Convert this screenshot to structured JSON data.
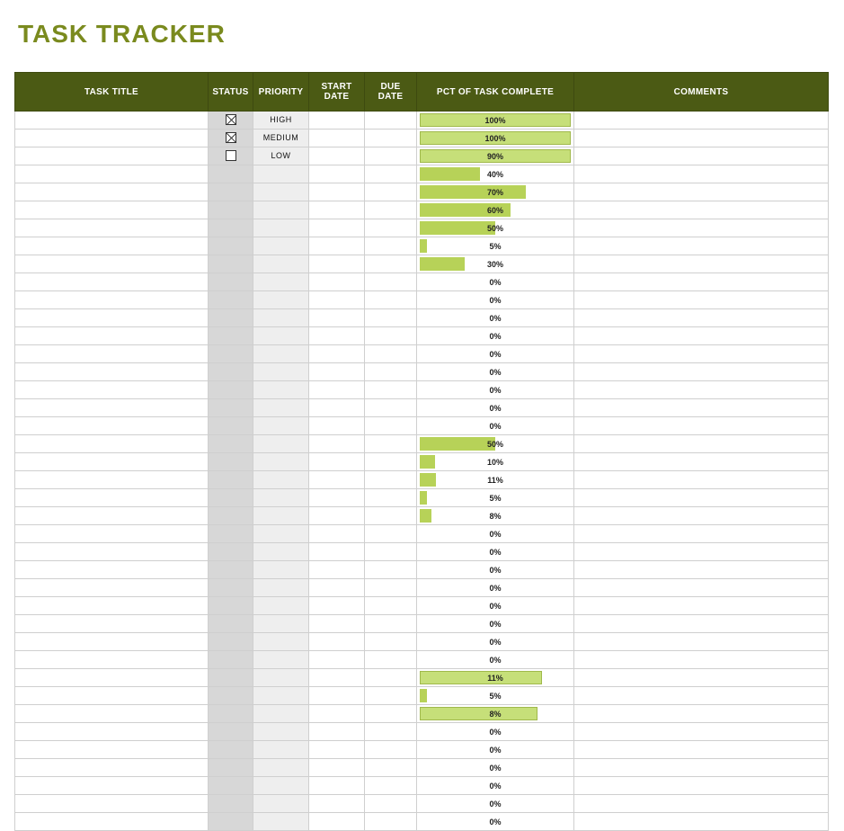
{
  "title": "TASK TRACKER",
  "columns": {
    "task_title": "TASK TITLE",
    "status": "STATUS",
    "priority": "PRIORITY",
    "start_date": "START DATE",
    "due_date": "DUE DATE",
    "pct": "PCT OF TASK COMPLETE",
    "comments": "COMMENTS"
  },
  "rows": [
    {
      "status_checked": true,
      "priority": "HIGH",
      "pct": 100,
      "wide": true
    },
    {
      "status_checked": true,
      "priority": "MEDIUM",
      "pct": 100,
      "wide": true
    },
    {
      "status_checked": false,
      "priority": "LOW",
      "pct": 90,
      "wide": true
    },
    {
      "pct": 40
    },
    {
      "pct": 70
    },
    {
      "pct": 60
    },
    {
      "pct": 50
    },
    {
      "pct": 5
    },
    {
      "pct": 30
    },
    {
      "pct": 0
    },
    {
      "pct": 0
    },
    {
      "pct": 0
    },
    {
      "pct": 0
    },
    {
      "pct": 0
    },
    {
      "pct": 0
    },
    {
      "pct": 0
    },
    {
      "pct": 0
    },
    {
      "pct": 0
    },
    {
      "pct": 50
    },
    {
      "pct": 10
    },
    {
      "pct": 11
    },
    {
      "pct": 5
    },
    {
      "pct": 8
    },
    {
      "pct": 0
    },
    {
      "pct": 0
    },
    {
      "pct": 0
    },
    {
      "pct": 0
    },
    {
      "pct": 0
    },
    {
      "pct": 0
    },
    {
      "pct": 0
    },
    {
      "pct": 0
    },
    {
      "pct": 11,
      "wide": true
    },
    {
      "pct": 5
    },
    {
      "pct": 8,
      "wide": true
    },
    {
      "pct": 0
    },
    {
      "pct": 0
    },
    {
      "pct": 0
    },
    {
      "pct": 0
    },
    {
      "pct": 0
    },
    {
      "pct": 0
    }
  ]
}
